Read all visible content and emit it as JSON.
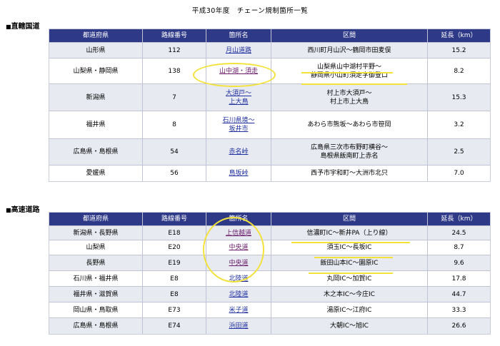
{
  "document": {
    "title": "平成30年度　チェーン規制箇所一覧"
  },
  "columns": [
    "都道府県",
    "路線番号",
    "箇所名",
    "区間",
    "延長（km）"
  ],
  "sections": [
    {
      "heading": "直轄国道",
      "rows": [
        {
          "pref": "山形県",
          "route": "112",
          "names": [
            "月山道路"
          ],
          "section": [
            "西川町月山沢～鶴岡市田麦俣"
          ],
          "length": "15.2"
        },
        {
          "pref": "山梨県・静岡県",
          "route": "138",
          "names": [
            "山中湖・須走"
          ],
          "section": [
            "山梨県山中湖村平野～",
            "静岡県小山町須走字御登口"
          ],
          "length": "8.2"
        },
        {
          "pref": "新潟県",
          "route": "7",
          "names": [
            "大須戸～",
            "上大鳥"
          ],
          "section": [
            "村上市大須戸～",
            "村上市上大鳥"
          ],
          "length": "15.3"
        },
        {
          "pref": "福井県",
          "route": "8",
          "names": [
            "石川県境～",
            "坂井市"
          ],
          "section": [
            "あわら市熊坂～あわら市笹岡"
          ],
          "length": "3.2"
        },
        {
          "pref": "広島県・島根県",
          "route": "54",
          "names": [
            "赤名峠"
          ],
          "section": [
            "広島県三次市布野町横谷～",
            "島根県飯南町上赤名"
          ],
          "length": "2.5"
        },
        {
          "pref": "愛媛県",
          "route": "56",
          "names": [
            "鳥坂峠"
          ],
          "section": [
            "西予市宇和町～大洲市北只"
          ],
          "length": "7.0"
        }
      ]
    },
    {
      "heading": "高速道路",
      "rows": [
        {
          "pref": "新潟県・長野県",
          "route": "E18",
          "names": [
            "上信越道"
          ],
          "section": [
            "信濃町IC～新井PA（上り線）"
          ],
          "length": "24.5"
        },
        {
          "pref": "山梨県",
          "route": "E20",
          "names": [
            "中央道"
          ],
          "section": [
            "須玉IC～長坂IC"
          ],
          "length": "8.7"
        },
        {
          "pref": "長野県",
          "route": "E19",
          "names": [
            "中央道"
          ],
          "section": [
            "飯田山本IC～園原IC"
          ],
          "length": "9.6"
        },
        {
          "pref": "石川県・福井県",
          "route": "E8",
          "names": [
            "北陸道"
          ],
          "section": [
            "丸岡IC～加賀IC"
          ],
          "length": "17.8"
        },
        {
          "pref": "福井県・滋賀県",
          "route": "E8",
          "names": [
            "北陸道"
          ],
          "section": [
            "木之本IC～今庄IC"
          ],
          "length": "44.7"
        },
        {
          "pref": "岡山県・鳥取県",
          "route": "E73",
          "names": [
            "米子道"
          ],
          "section": [
            "湯原IC～江府IC"
          ],
          "length": "33.3"
        },
        {
          "pref": "広島県・島根県",
          "route": "E74",
          "names": [
            "浜田道"
          ],
          "section": [
            "大朝IC～旭IC"
          ],
          "length": "26.6"
        }
      ]
    }
  ],
  "colors": {
    "header_bg": "#2e3a87",
    "row_alt_bg": "#e8eaf1",
    "link": "#1f2f9f",
    "link_visited": "#6a1b6a",
    "highlight": "#f3e23a"
  }
}
